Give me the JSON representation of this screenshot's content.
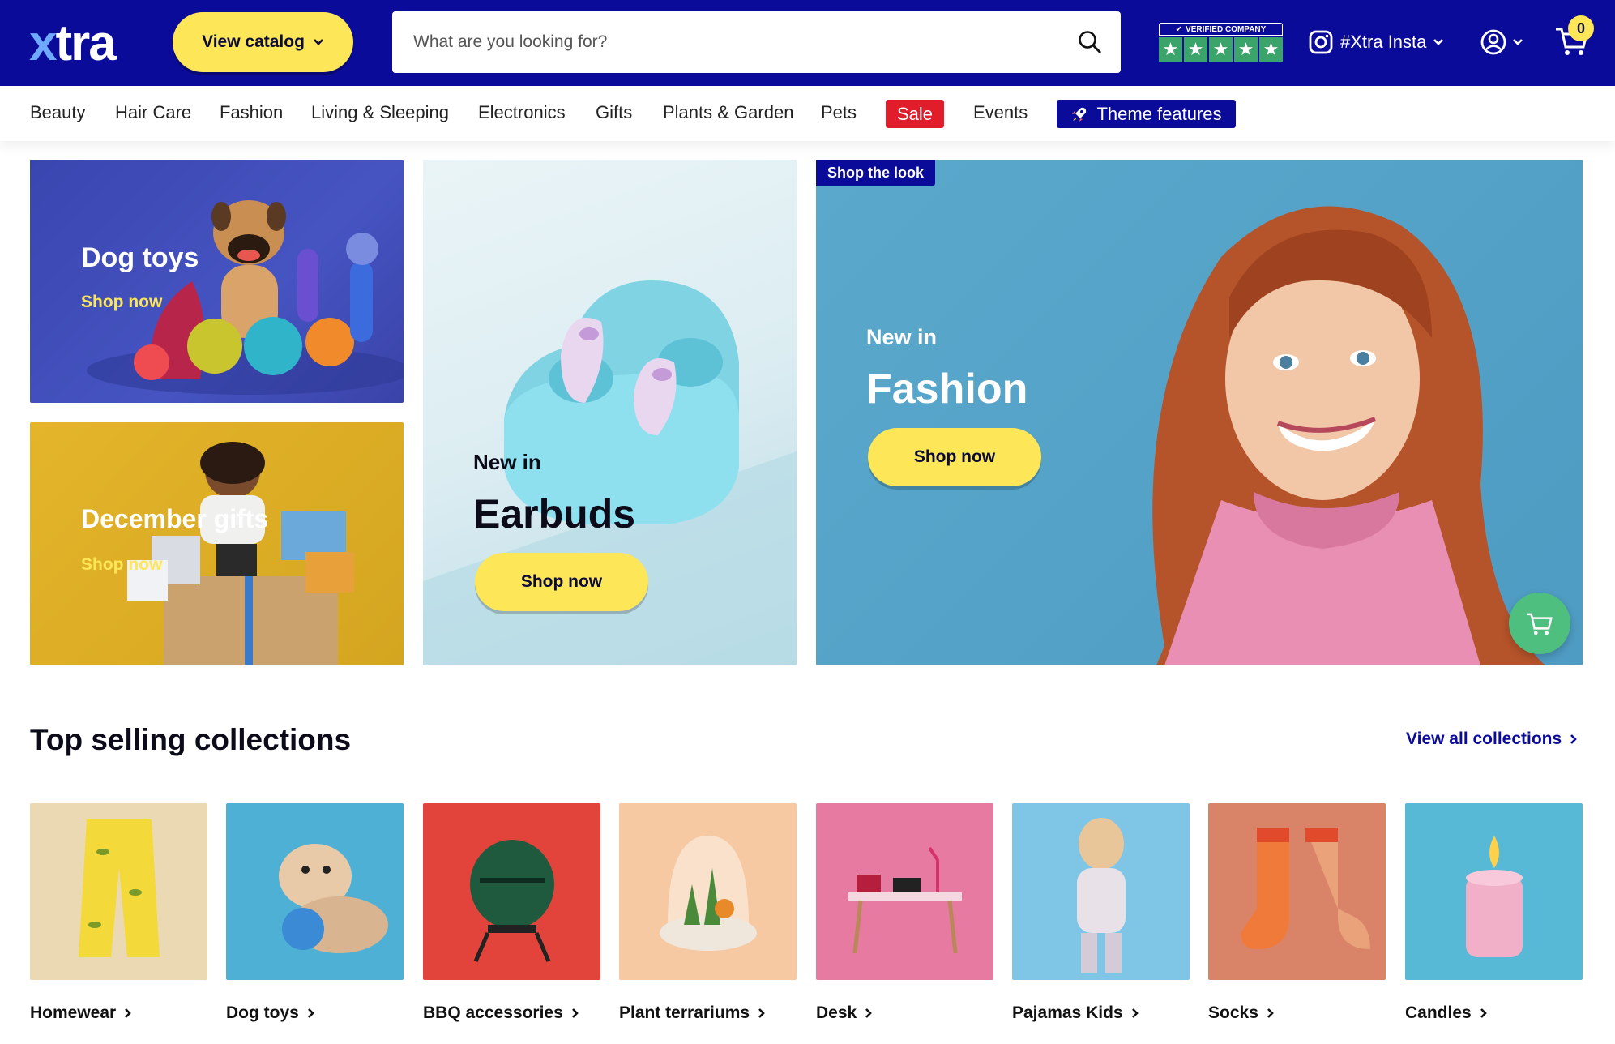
{
  "header": {
    "logo_accent": "x",
    "logo_rest": "tra",
    "catalog_label": "View catalog",
    "search_placeholder": "What are you looking for?",
    "verified_label": "VERIFIED COMPANY",
    "insta_label": "#Xtra Insta",
    "cart_count": "0"
  },
  "nav": {
    "items": [
      "Beauty",
      "Hair Care",
      "Fashion",
      "Living & Sleeping",
      "Electronics",
      "Gifts",
      "Plants & Garden",
      "Pets"
    ],
    "sale": "Sale",
    "events": "Events",
    "theme": "Theme features"
  },
  "hero": {
    "dog": {
      "title": "Dog toys",
      "link": "Shop now"
    },
    "gifts": {
      "title": "December gifts",
      "link": "Shop now"
    },
    "earbuds": {
      "kicker": "New in",
      "title": "Earbuds",
      "button": "Shop now"
    },
    "fashion": {
      "badge": "Shop the look",
      "kicker": "New in",
      "title": "Fashion",
      "button": "Shop now"
    }
  },
  "collections": {
    "title": "Top selling collections",
    "view_all": "View all collections",
    "items": [
      {
        "label": "Homewear"
      },
      {
        "label": "Dog toys"
      },
      {
        "label": "BBQ accessories"
      },
      {
        "label": "Plant terrariums"
      },
      {
        "label": "Desk"
      },
      {
        "label": "Pajamas Kids"
      },
      {
        "label": "Socks"
      },
      {
        "label": "Candles"
      }
    ]
  },
  "colors": {
    "brand": "#0b0b9a",
    "accent": "#fde657",
    "sale": "#e11d2b",
    "trust": "#3aa46a"
  }
}
